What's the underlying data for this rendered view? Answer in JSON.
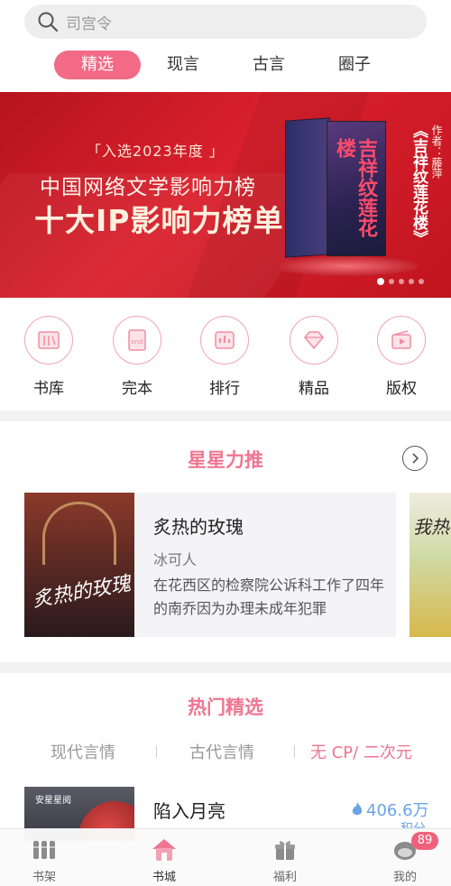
{
  "search": {
    "placeholder": "司宫令"
  },
  "top_tabs": [
    "精选",
    "现言",
    "古言",
    "圈子"
  ],
  "banner": {
    "tag": "「入选2023年度 」",
    "line1": "中国网络文学影响力榜",
    "line2": "十大IP影响力榜单",
    "book_title_vertical": "《吉祥纹莲花楼》",
    "author_vertical": "作者：藤萍",
    "cover_title": "吉祥纹莲花楼",
    "page_count": 5,
    "active_page": 1
  },
  "categories": [
    {
      "label": "书库",
      "icon": "library-icon"
    },
    {
      "label": "完本",
      "icon": "end-book-icon"
    },
    {
      "label": "排行",
      "icon": "ranking-icon"
    },
    {
      "label": "精品",
      "icon": "diamond-icon"
    },
    {
      "label": "版权",
      "icon": "film-icon"
    }
  ],
  "recommend": {
    "title": "星星力推",
    "book": {
      "title": "炙热的玫瑰",
      "author": "冰可人",
      "desc": "在花西区的检察院公诉科工作了四年的南乔因为办理未成年犯罪",
      "cover_text": "炙热的玫瑰"
    },
    "next_cover_text": "我热"
  },
  "hot": {
    "title": "热门精选",
    "subtabs": [
      "现代言情",
      "古代言情",
      "无 CP/ 二次元"
    ],
    "active_subtab": 2,
    "book": {
      "title": "陷入月亮",
      "score": "406.6万",
      "score_unit": "积分",
      "cover_logo": "安星星阅"
    }
  },
  "bottom_nav": [
    {
      "label": "书架",
      "icon": "bookshelf-icon"
    },
    {
      "label": "书城",
      "icon": "bookstore-icon"
    },
    {
      "label": "福利",
      "icon": "gift-icon"
    },
    {
      "label": "我的",
      "icon": "profile-icon"
    }
  ],
  "active_nav": 1,
  "badge": "89",
  "colors": {
    "accent": "#f26a85",
    "title_pink": "#ef7591",
    "score_blue": "#6aa4e6"
  }
}
